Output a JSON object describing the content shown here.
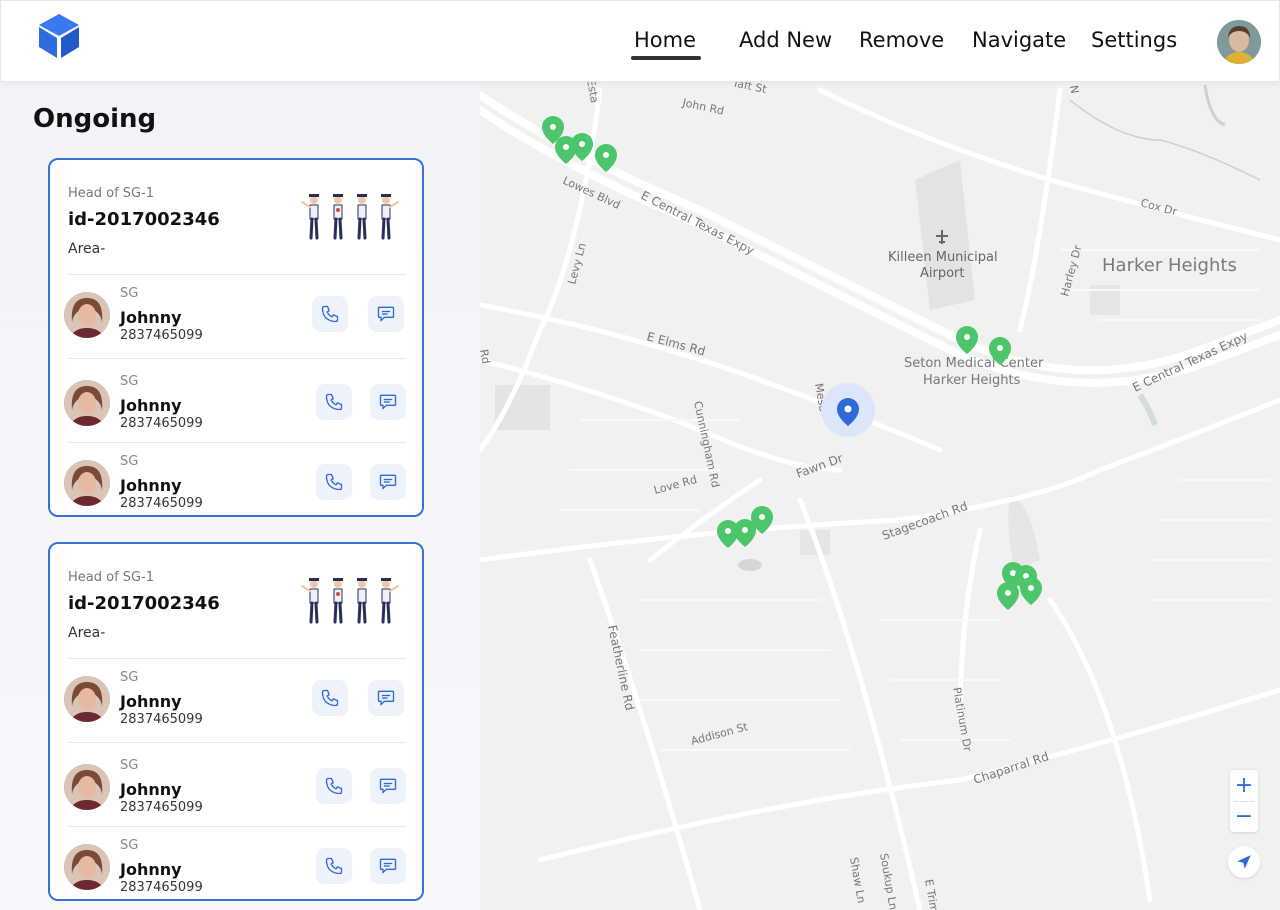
{
  "nav": {
    "items": [
      {
        "label": "Home",
        "active": true
      },
      {
        "label": "Add New"
      },
      {
        "label": "Remove"
      },
      {
        "label": "Navigate"
      },
      {
        "label": "Settings"
      }
    ]
  },
  "section_title": "Ongoing",
  "cards": [
    {
      "subtitle": "Head of SG-1",
      "id": "id-2017002346",
      "area": "Area-",
      "members": [
        {
          "role": "SG",
          "name": "Johnny",
          "phone": "2837465099"
        },
        {
          "role": "SG",
          "name": "Johnny",
          "phone": "2837465099"
        },
        {
          "role": "SG",
          "name": "Johnny",
          "phone": "2837465099"
        }
      ]
    },
    {
      "subtitle": "Head of SG-1",
      "id": "id-2017002346",
      "area": "Area-",
      "members": [
        {
          "role": "SG",
          "name": "Johnny",
          "phone": "2837465099"
        },
        {
          "role": "SG",
          "name": "Johnny",
          "phone": "2837465099"
        },
        {
          "role": "SG",
          "name": "Johnny",
          "phone": "2837465099"
        }
      ]
    }
  ],
  "map": {
    "labels": {
      "harker_heights": "Harker Heights",
      "airport_1": "Killeen Municipal",
      "airport_2": "Airport",
      "medical_1": "Seton Medical Center",
      "medical_2": "Harker Heights",
      "e_central_1": "E Central Texas Expy",
      "e_central_2": "E Central Texas Expy",
      "lowes": "Lowes Blvd",
      "levy": "Levy Ln",
      "john": "John Rd",
      "taft": "Taft St",
      "cox": "Cox Dr",
      "harley": "Harley Dr",
      "elms": "E Elms Rd",
      "cunningham": "Cunningham Rd",
      "mesa": "Mesa",
      "fawn": "Fawn Dr",
      "love": "Love Rd",
      "stagecoach": "Stagecoach Rd",
      "featherline": "Featherline Rd",
      "addison": "Addison St",
      "platinum": "Platinum Dr",
      "chaparral": "Chaparral Rd",
      "shaw": "Shaw Ln",
      "soukup": "Soukup Ln",
      "e_trimmier": "E Trim",
      "rd_left": "Rd",
      "esta": "Esta",
      "n": "N"
    },
    "zoom_in": "+",
    "zoom_out": "−",
    "pin_color": "#4cc56b",
    "current_location_color": "#2e6bd7"
  },
  "colors": {
    "accent": "#3b6fd8",
    "logo": "#2f6ae0"
  },
  "icons": {
    "logo": "cube-logo-icon",
    "call": "phone-icon",
    "message": "chat-icon",
    "location_pin": "map-pin-icon",
    "locate": "navigation-arrow-icon"
  }
}
